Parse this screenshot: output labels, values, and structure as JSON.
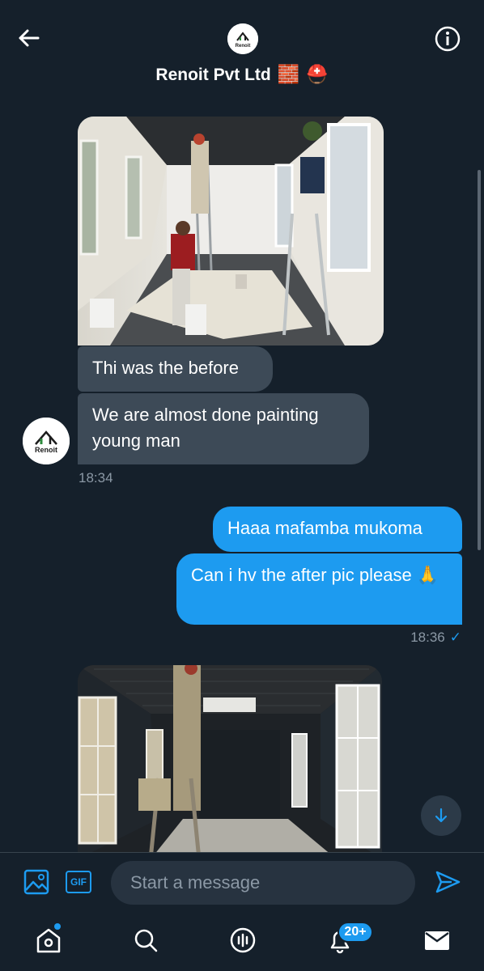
{
  "header": {
    "title": "Renoit Pvt Ltd",
    "title_emojis": [
      "🧱",
      "⛑️"
    ],
    "avatar_text": "Renoit"
  },
  "messages": {
    "received": [
      {
        "text": "Thi was the before"
      },
      {
        "text": "We are almost done painting young man"
      }
    ],
    "received_time": "18:34",
    "sender_avatar_text": "Renoit",
    "sent": [
      {
        "text": "Haaa mafamba mukoma"
      },
      {
        "text": "Can i hv the after pic please 🙏"
      }
    ],
    "sent_time": "18:36",
    "read_mark": "✓"
  },
  "composer": {
    "placeholder": "Start a message",
    "gif_label": "GIF"
  },
  "nav": {
    "notifications_badge": "20+"
  },
  "icons": [
    "back-arrow-icon",
    "info-icon",
    "image-icon",
    "gif-icon",
    "send-icon",
    "home-icon",
    "search-icon",
    "spaces-icon",
    "bell-icon",
    "mail-icon",
    "arrow-down-icon"
  ],
  "colors": {
    "background": "#15202b",
    "received_bubble": "#3d4a57",
    "sent_bubble": "#1d9bf0",
    "accent": "#1d9bf0",
    "muted_text": "#8b98a5"
  }
}
